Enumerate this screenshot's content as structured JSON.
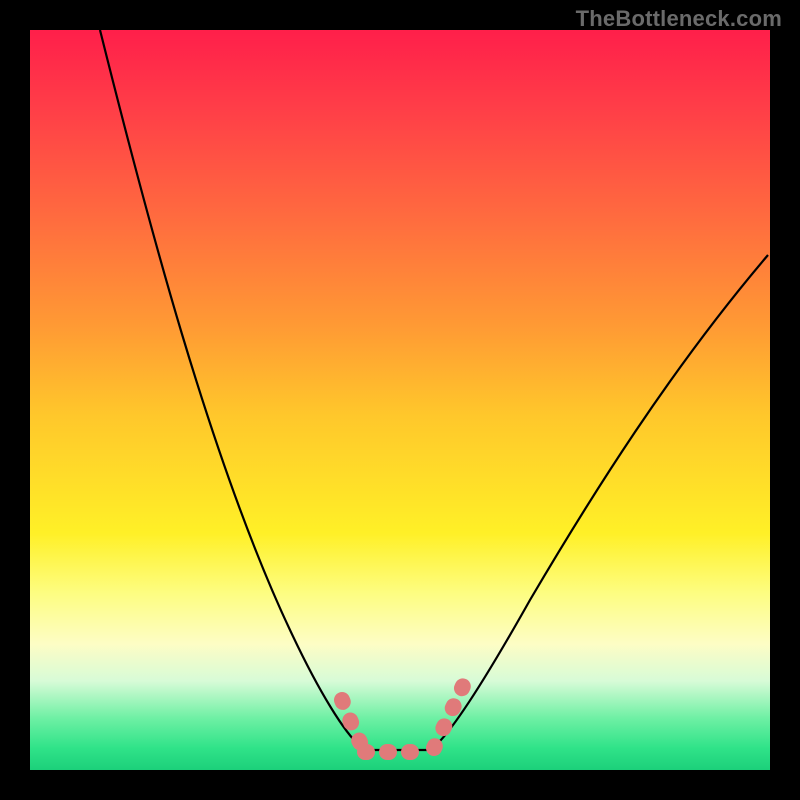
{
  "watermark": {
    "text": "TheBottleneck.com"
  },
  "chart_data": {
    "type": "line",
    "title": "",
    "xlabel": "",
    "ylabel": "",
    "note": "Chart has no visible axes, tick labels, or numeric annotations; only a V-shaped curve over a vertical rainbow gradient with a highlighted minimum region.",
    "background_gradient": {
      "orientation": "vertical",
      "stops": [
        {
          "pos": 0.0,
          "color": "#ff1f4a"
        },
        {
          "pos": 0.25,
          "color": "#ff6a3f"
        },
        {
          "pos": 0.52,
          "color": "#ffc72b"
        },
        {
          "pos": 0.68,
          "color": "#fff027"
        },
        {
          "pos": 0.88,
          "color": "#d7fbd7"
        },
        {
          "pos": 1.0,
          "color": "#1cd07a"
        }
      ]
    },
    "series": [
      {
        "name": "curve",
        "color": "#000000",
        "note": "x,y are fractions of plot area width/height with origin at top-left (y=0 top, y=1 bottom).",
        "points": [
          {
            "x": 0.095,
            "y": 0.0
          },
          {
            "x": 0.155,
            "y": 0.243
          },
          {
            "x": 0.243,
            "y": 0.581
          },
          {
            "x": 0.351,
            "y": 0.811
          },
          {
            "x": 0.392,
            "y": 0.897
          },
          {
            "x": 0.426,
            "y": 0.95
          },
          {
            "x": 0.446,
            "y": 0.968
          },
          {
            "x": 0.446,
            "y": 0.973
          },
          {
            "x": 0.541,
            "y": 0.973
          },
          {
            "x": 0.547,
            "y": 0.968
          },
          {
            "x": 0.572,
            "y": 0.946
          },
          {
            "x": 0.615,
            "y": 0.878
          },
          {
            "x": 0.676,
            "y": 0.77
          },
          {
            "x": 0.757,
            "y": 0.632
          },
          {
            "x": 0.865,
            "y": 0.459
          },
          {
            "x": 0.997,
            "y": 0.304
          }
        ]
      }
    ],
    "highlight": {
      "color": "#e07a7a",
      "style": "dotted-thick",
      "segments": [
        {
          "name": "left",
          "from": {
            "x": 0.422,
            "y": 0.905
          },
          "to": {
            "x": 0.45,
            "y": 0.97
          }
        },
        {
          "name": "bottom",
          "from": {
            "x": 0.453,
            "y": 0.976
          },
          "to": {
            "x": 0.541,
            "y": 0.976
          }
        },
        {
          "name": "right",
          "from": {
            "x": 0.546,
            "y": 0.97
          },
          "to": {
            "x": 0.592,
            "y": 0.872
          }
        }
      ]
    }
  }
}
